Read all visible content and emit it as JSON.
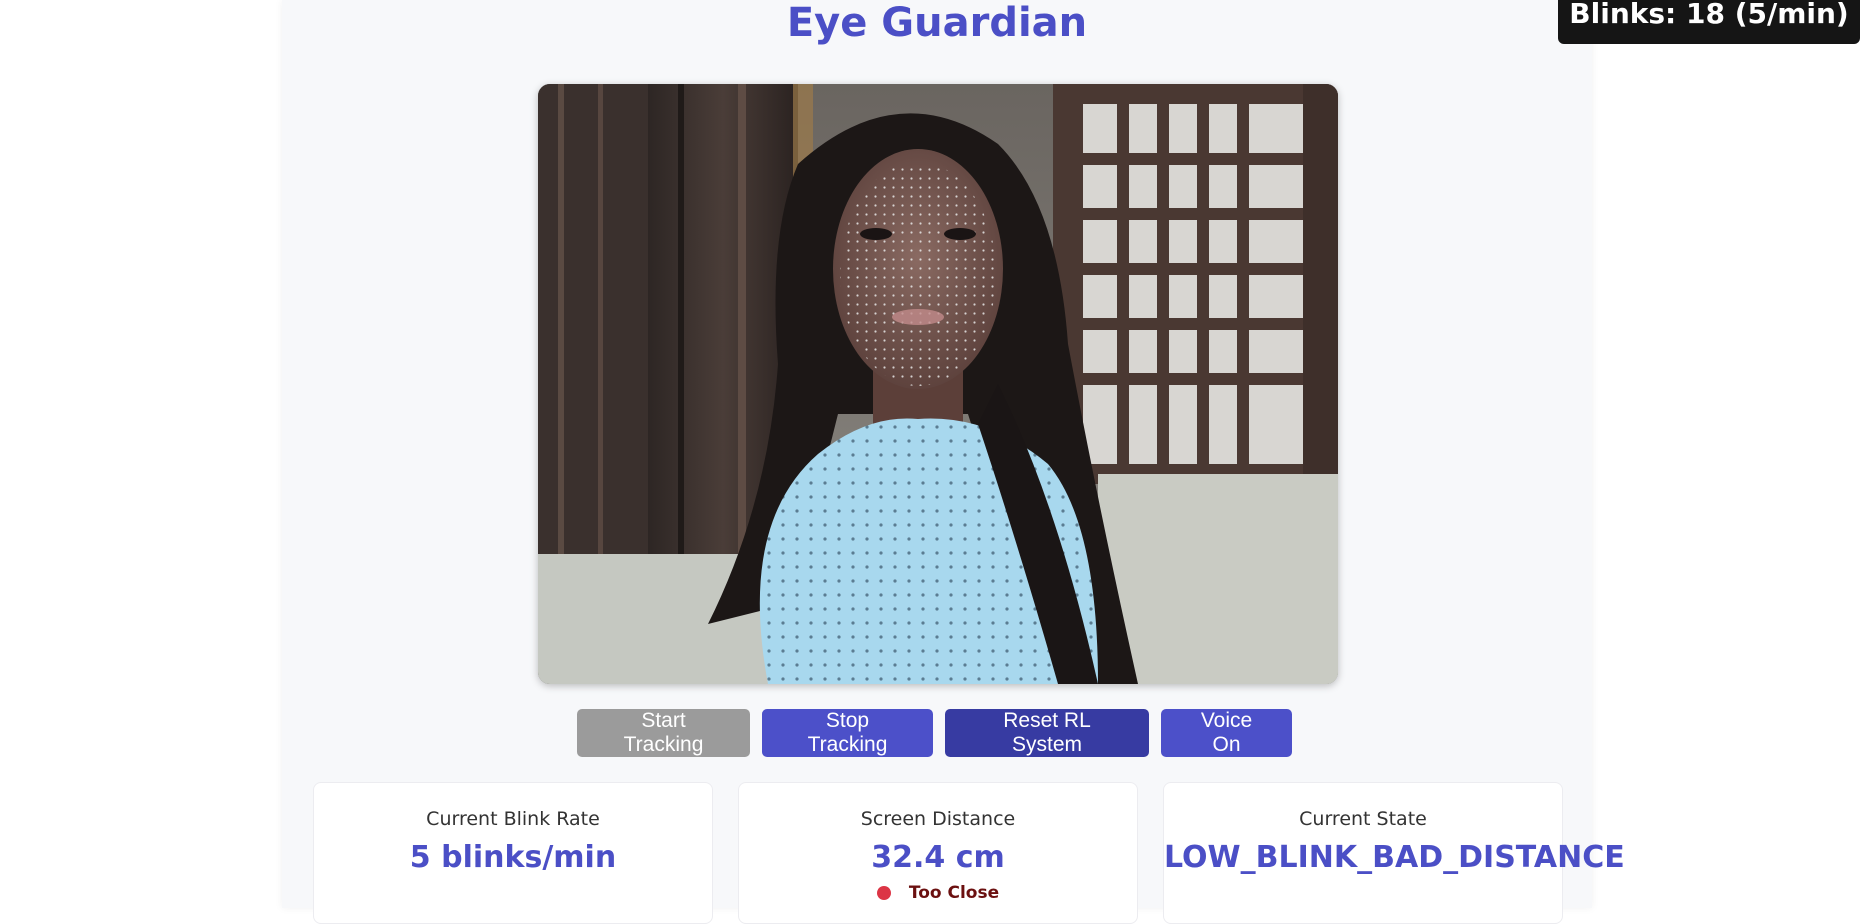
{
  "app": {
    "title": "Eye Guardian"
  },
  "overlay": {
    "blink_counter": "Blinks: 18 (5/min)"
  },
  "video": {
    "description": "webcam feed with face mesh"
  },
  "controls": {
    "start_label": "Start Tracking",
    "stop_label": "Stop Tracking",
    "reset_label": "Reset RL System",
    "voice_label": "Voice On"
  },
  "stats": {
    "blink_rate": {
      "label": "Current Blink Rate",
      "value": "5 blinks/min"
    },
    "screen_distance": {
      "label": "Screen Distance",
      "value": "32.4 cm",
      "status": "Too Close"
    },
    "current_state": {
      "label": "Current State",
      "value": "LOW_BLINK_BAD_DISTANCE"
    }
  },
  "colors": {
    "accent": "#4b4fc6",
    "accent_dark": "#373ba2",
    "disabled": "#9b9b9b",
    "danger": "#dc3545"
  }
}
